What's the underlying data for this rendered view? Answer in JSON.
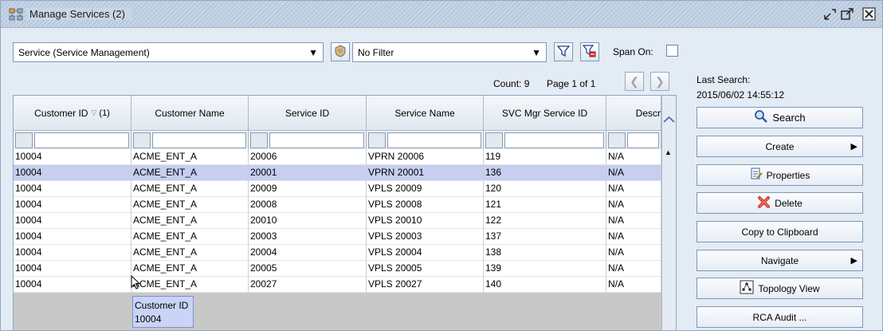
{
  "window": {
    "title": "Manage Services (2)"
  },
  "toolbar": {
    "type_select": "Service (Service Management)",
    "filter_select": "No Filter",
    "span_label": "Span On:"
  },
  "paging": {
    "count": "Count: 9",
    "page": "Page 1 of 1"
  },
  "last_search": {
    "label": "Last Search:",
    "value": "2015/06/02 14:55:12"
  },
  "table": {
    "columns": [
      "Customer ID",
      "Customer Name",
      "Service ID",
      "Service Name",
      "SVC Mgr Service ID",
      "Descr"
    ],
    "sort_indicator": "(1)",
    "rows": [
      [
        "10004",
        "ACME_ENT_A",
        "20006",
        "VPRN 20006",
        "119",
        "N/A"
      ],
      [
        "10004",
        "ACME_ENT_A",
        "20001",
        "VPRN 20001",
        "136",
        "N/A"
      ],
      [
        "10004",
        "ACME_ENT_A",
        "20009",
        "VPLS 20009",
        "120",
        "N/A"
      ],
      [
        "10004",
        "ACME_ENT_A",
        "20008",
        "VPLS 20008",
        "121",
        "N/A"
      ],
      [
        "10004",
        "ACME_ENT_A",
        "20010",
        "VPLS 20010",
        "122",
        "N/A"
      ],
      [
        "10004",
        "ACME_ENT_A",
        "20003",
        "VPLS 20003",
        "137",
        "N/A"
      ],
      [
        "10004",
        "ACME_ENT_A",
        "20004",
        "VPLS 20004",
        "138",
        "N/A"
      ],
      [
        "10004",
        "ACME_ENT_A",
        "20005",
        "VPLS 20005",
        "139",
        "N/A"
      ],
      [
        "10004",
        "ACME_ENT_A",
        "20027",
        "VPLS 20027",
        "140",
        "N/A"
      ]
    ]
  },
  "tooltip": {
    "line1": "Customer ID",
    "line2": "10004"
  },
  "actions": {
    "search": "Search",
    "create": "Create",
    "properties": "Properties",
    "delete": "Delete",
    "copy": "Copy to Clipboard",
    "navigate": "Navigate",
    "topology": "Topology View",
    "rca": "RCA Audit ..."
  }
}
